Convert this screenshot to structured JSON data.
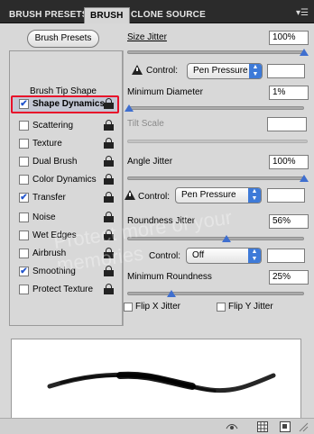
{
  "tabs": [
    {
      "label": "BRUSH PRESETS"
    },
    {
      "label": "BRUSH"
    },
    {
      "label": "CLONE SOURCE"
    }
  ],
  "left": {
    "presets_button": "Brush Presets",
    "section_label": "Brush Tip Shape",
    "options": [
      {
        "label": "Shape Dynamics",
        "checked": true,
        "selected": true
      },
      {
        "label": "Scattering",
        "checked": false
      },
      {
        "label": "Texture",
        "checked": false
      },
      {
        "label": "Dual Brush",
        "checked": false
      },
      {
        "label": "Color Dynamics",
        "checked": false
      },
      {
        "label": "Transfer",
        "checked": true
      },
      {
        "label": "Noise",
        "checked": false
      },
      {
        "label": "Wet Edges",
        "checked": false
      },
      {
        "label": "Airbrush",
        "checked": false
      },
      {
        "label": "Smoothing",
        "checked": true
      },
      {
        "label": "Protect Texture",
        "checked": false
      }
    ]
  },
  "right": {
    "size_jitter": {
      "label": "Size Jitter",
      "value": "100%",
      "slider": 1.0
    },
    "control1": {
      "label": "Control:",
      "value": "Pen Pressure"
    },
    "min_diameter": {
      "label": "Minimum Diameter",
      "value": "1%",
      "slider": 0.01
    },
    "tilt_scale": {
      "label": "Tilt Scale"
    },
    "angle_jitter": {
      "label": "Angle Jitter",
      "value": "100%",
      "slider": 1.0
    },
    "control2": {
      "label": "Control:",
      "value": "Pen Pressure"
    },
    "roundness_jitter": {
      "label": "Roundness Jitter",
      "value": "56%",
      "slider": 0.56
    },
    "control3": {
      "label": "Control:",
      "value": "Off"
    },
    "min_roundness": {
      "label": "Minimum Roundness",
      "value": "25%",
      "slider": 0.25
    },
    "flip_x": {
      "label": "Flip X Jitter"
    },
    "flip_y": {
      "label": "Flip Y Jitter"
    }
  },
  "watermark": "Protect more of your memories",
  "colors": {
    "highlight": "#e8102a",
    "thumb": "#3f6fcf",
    "select_arrow": "#3e7ad8"
  }
}
